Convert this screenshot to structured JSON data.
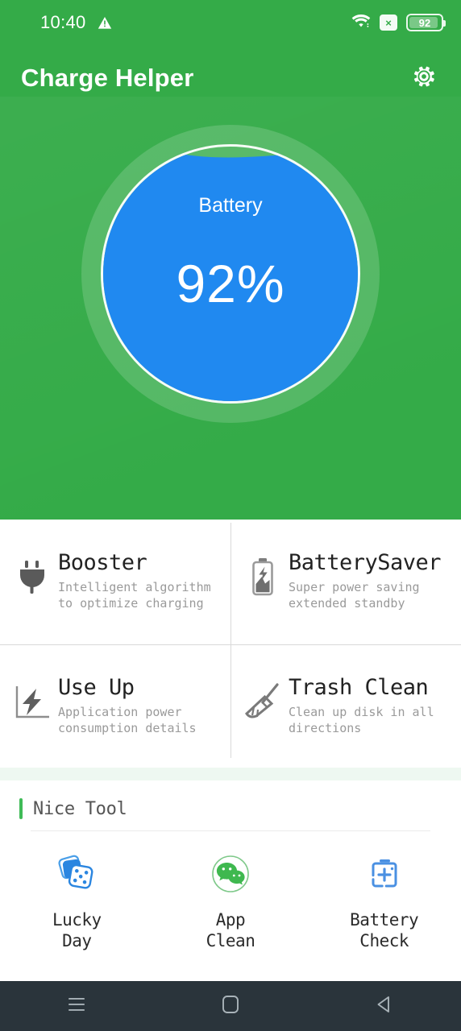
{
  "statusbar": {
    "time": "10:40",
    "warning_icon": "warning-triangle-icon",
    "wifi_icon": "wifi-icon",
    "signal_off_badge": "×",
    "battery_level": "92"
  },
  "appbar": {
    "title": "Charge Helper",
    "settings_icon": "gear-icon"
  },
  "gauge": {
    "label": "Battery",
    "value": "92%",
    "percent": 92,
    "fill_color": "#2089f0",
    "ring_color": "#ffffff",
    "background_color": "#34ab48"
  },
  "features": [
    {
      "icon": "plug-icon",
      "title": "Booster",
      "subtitle": "Intelligent algorithm\nto optimize charging"
    },
    {
      "icon": "battery-bolt-icon",
      "title": "BatterySaver",
      "subtitle": "Super power saving\nextended standby"
    },
    {
      "icon": "power-usage-chart-icon",
      "title": "Use Up",
      "subtitle": "Application power\nconsumption details"
    },
    {
      "icon": "broom-icon",
      "title": "Trash Clean",
      "subtitle": "Clean up disk in all\ndirections"
    }
  ],
  "tools_section": {
    "title": "Nice Tool",
    "accent_color": "#3fbb57",
    "items": [
      {
        "icon": "dice-icon",
        "label": "Lucky\nDay",
        "color": "#2b86e0"
      },
      {
        "icon": "chat-bubbles-icon",
        "label": "App\nClean",
        "color": "#3fb84f"
      },
      {
        "icon": "battery-plus-icon",
        "label": "Battery\nCheck",
        "color": "#4a90e2"
      }
    ]
  },
  "navbar": {
    "recents_icon": "menu-icon",
    "home_icon": "home-square-icon",
    "back_icon": "back-triangle-icon"
  }
}
